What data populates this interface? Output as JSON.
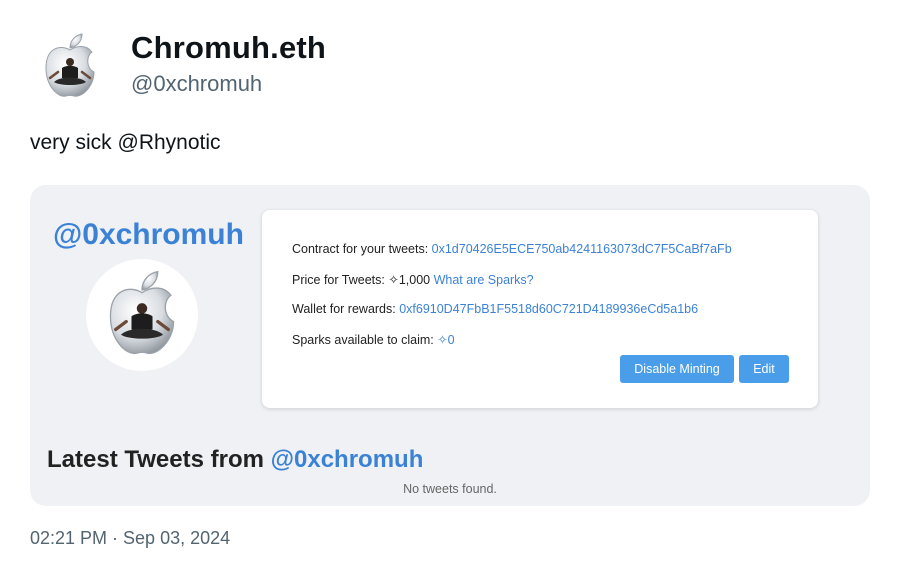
{
  "author": {
    "display_name": "Chromuh.eth",
    "handle": "@0xchromuh"
  },
  "tweet": {
    "text": "very sick @Rhynotic",
    "timestamp": "02:21 PM · Sep 03, 2024"
  },
  "embed": {
    "handle": "@0xchromuh",
    "contract_label": "Contract for your tweets: ",
    "contract_value": "0x1d70426E5ECE750ab4241163073dC7F5CaBf7aFb",
    "price_label": "Price for Tweets: ",
    "price_value": "✧1,000",
    "sparks_link": "What are Sparks?",
    "wallet_label": "Wallet for rewards: ",
    "wallet_value": "0xf6910D47FbB1F5518d60C721D4189936eCd5a1b6",
    "claim_label": "Sparks available to claim: ",
    "claim_value": "✧0",
    "disable_button": "Disable Minting",
    "edit_button": "Edit",
    "latest_prefix": "Latest Tweets from ",
    "latest_handle": "@0xchromuh",
    "no_tweets": "No tweets found."
  },
  "colors": {
    "accent": "#3b82d6",
    "button": "#4a9de8",
    "card_bg": "#eff1f5"
  }
}
